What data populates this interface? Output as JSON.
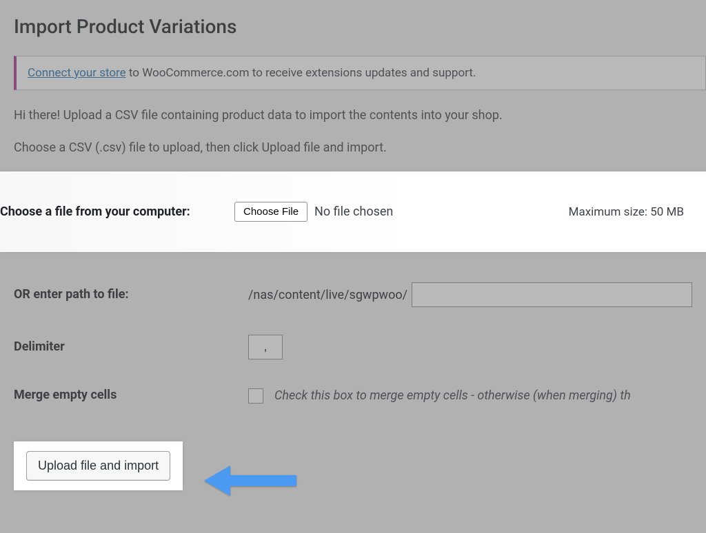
{
  "page": {
    "title": "Import Product Variations",
    "notice_link": "Connect your store",
    "notice_text": " to WooCommerce.com to receive extensions updates and support.",
    "intro1": "Hi there! Upload a CSV file containing product data to import the contents into your shop.",
    "intro2": "Choose a CSV (.csv) file to upload, then click Upload file and import."
  },
  "fields": {
    "choose_label": "Choose a file from your computer:",
    "choose_button": "Choose File",
    "file_status": "No file chosen",
    "max_size": "Maximum size: 50 MB",
    "path_label": "OR enter path to file:",
    "path_prefix": "/nas/content/live/sgwpwoo/",
    "path_value": "",
    "delimiter_label": "Delimiter",
    "delimiter_value": ",",
    "merge_label": "Merge empty cells",
    "merge_help": "Check this box to merge empty cells - otherwise (when merging) th"
  },
  "submit": {
    "label": "Upload file and import"
  }
}
